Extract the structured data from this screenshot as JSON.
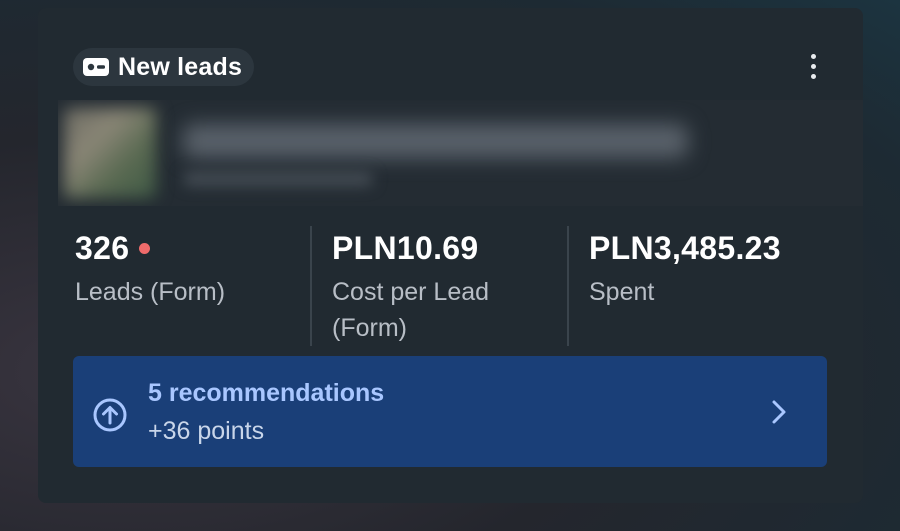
{
  "header": {
    "badge_label": "New leads",
    "badge_icon": "lead-form-icon",
    "menu_icon": "more-vertical-icon"
  },
  "ad_preview": {
    "thumbnail": "ad-thumbnail",
    "title_blurred": true
  },
  "stats": [
    {
      "value": "326",
      "label": "Leads (Form)",
      "indicator_color": "#ef6b6b"
    },
    {
      "value": "PLN10.69",
      "label": "Cost per Lead (Form)"
    },
    {
      "value": "PLN3,485.23",
      "label": "Spent"
    }
  ],
  "recommendations": {
    "title": "5 recommendations",
    "subtitle": "+36 points",
    "icon": "arrow-up-circle-icon",
    "chevron": "chevron-right-icon",
    "background": "#1a3f78"
  },
  "colors": {
    "card_bg": "#212a31",
    "accent_text": "#a9c7ff",
    "primary_text": "#ffffff",
    "secondary_text": "#b8bec6"
  }
}
